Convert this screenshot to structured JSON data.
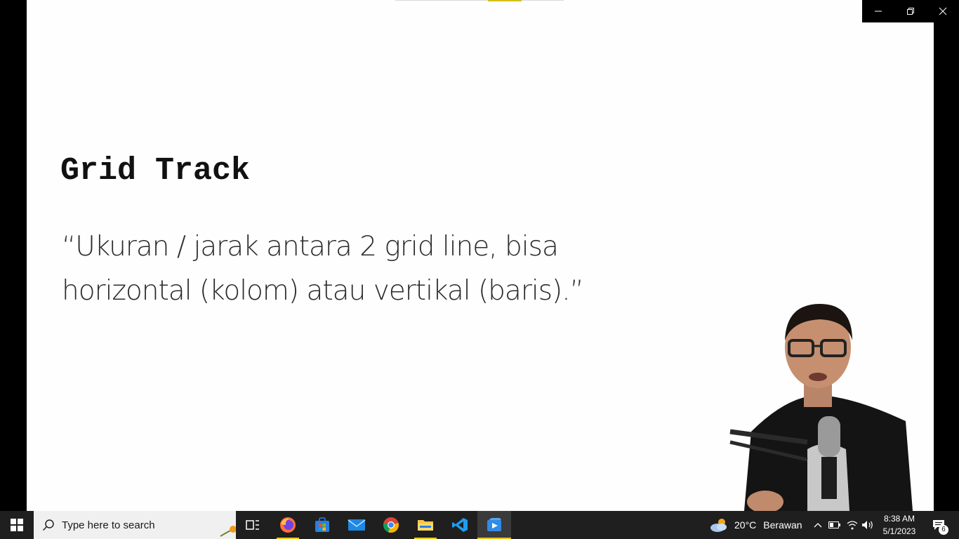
{
  "slide": {
    "title": "Grid Track",
    "quote_line1": "“Ukuran / jarak antara 2 grid line, bisa",
    "quote_line2": "horizontal (kolom) atau vertikal (baris).”",
    "progress_fraction": 0.2
  },
  "window_controls": {
    "minimize_icon": "minimize-icon",
    "restore_icon": "restore-icon",
    "close_icon": "close-icon"
  },
  "taskbar": {
    "search_placeholder": "Type here to search",
    "apps": [
      "task-view",
      "firefox",
      "microsoft-store",
      "mail",
      "chrome",
      "file-explorer",
      "vscode",
      "media-player"
    ],
    "accent_color": "#f2c811",
    "weather": {
      "temperature": "20°C",
      "condition": "Berawan"
    },
    "clock": {
      "time": "8:38 AM",
      "date": "5/1/2023"
    },
    "notification_count": "6"
  }
}
